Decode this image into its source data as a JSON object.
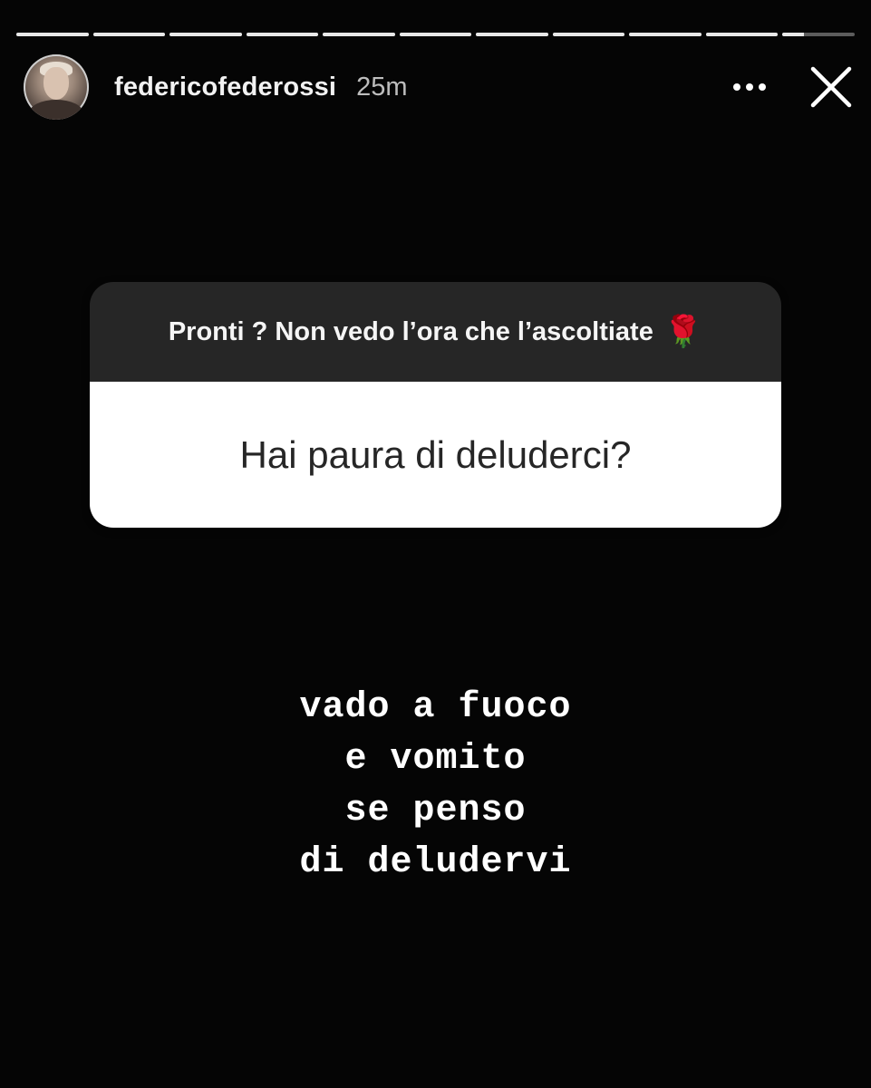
{
  "progress": {
    "segments": [
      1,
      1,
      1,
      1,
      1,
      1,
      1,
      1,
      1,
      1,
      0.3
    ],
    "fill_color": "#e8e8e8"
  },
  "header": {
    "username": "federicofederossi",
    "time": "25m",
    "more_icon": "more-horizontal-icon",
    "close_icon": "close-icon"
  },
  "sticker": {
    "prompt": "Pronti ? Non vedo l’ora che l’ascoltiate",
    "prompt_emoji": "🌹",
    "question": "Hai paura di deluderci?"
  },
  "answer": {
    "lines": [
      "vado a fuoco",
      "e vomito",
      "se penso",
      "di deludervi"
    ]
  }
}
